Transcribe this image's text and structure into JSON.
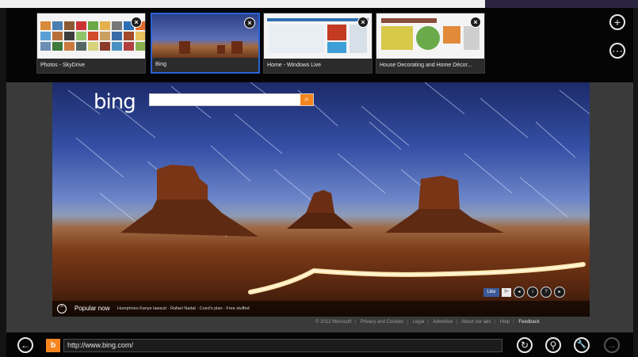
{
  "tabs": [
    {
      "caption": "Photos - SkyDrive",
      "thumb": "photos",
      "active": false
    },
    {
      "caption": "Bing",
      "thumb": "bing",
      "active": true
    },
    {
      "caption": "Home - Windows Live",
      "thumb": "live",
      "active": false
    },
    {
      "caption": "House Decorating and Home Décor...",
      "thumb": "house",
      "active": false
    }
  ],
  "tab_controls": {
    "new_tab_icon": "+",
    "more_icon": "⋯",
    "close_icon": "×"
  },
  "bing": {
    "logo": "bing",
    "search_icon": "⌕",
    "popular_now_label": "Popular now",
    "popular_items": "Humphries Kanye lawsuit · Rafael Nadal · Coed's plan · Free stuffed",
    "social": {
      "like": "Like",
      "share": "f+",
      "dots": [
        "◂",
        "i",
        "?",
        "▸"
      ]
    },
    "collapse_icon": "⌃"
  },
  "footer": {
    "copyright": "© 2012 Microsoft",
    "links": [
      "Privacy and Cookies",
      "Legal",
      "Advertise",
      "About our ads",
      "Help"
    ],
    "feedback": "Feedback"
  },
  "addressbar": {
    "back_icon": "←",
    "url": "http://www.bing.com/",
    "favicon": "b",
    "refresh_icon": "↻",
    "pin_icon": "⚲",
    "tools_icon": "🔧",
    "forward_icon": "→"
  },
  "colors": {
    "accent_active_tab": "#2a63d6",
    "bing_orange": "#f5861f"
  }
}
